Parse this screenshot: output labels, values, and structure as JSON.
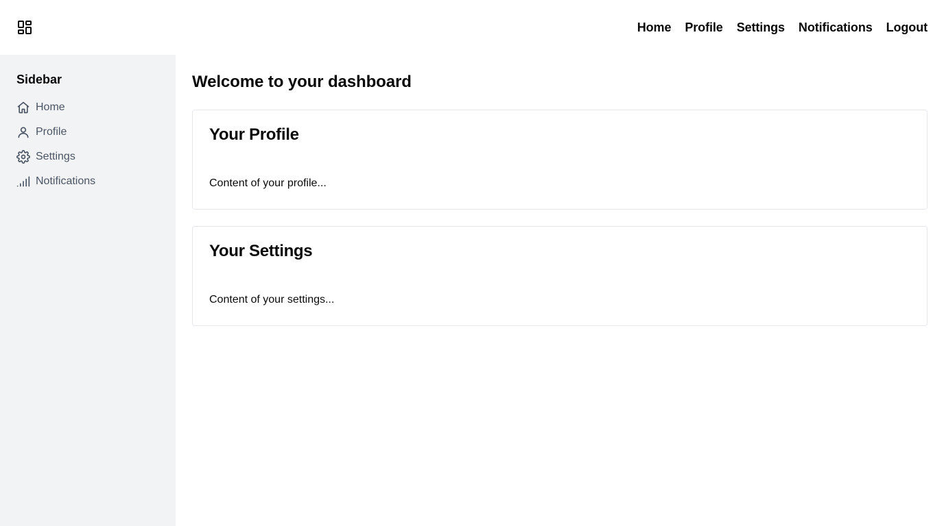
{
  "header": {
    "logo_icon": "dashboard-grid-icon",
    "nav": {
      "home": "Home",
      "profile": "Profile",
      "settings": "Settings",
      "notifications": "Notifications",
      "logout": "Logout"
    }
  },
  "sidebar": {
    "title": "Sidebar",
    "items": [
      {
        "label": "Home",
        "icon": "home-icon"
      },
      {
        "label": "Profile",
        "icon": "user-icon"
      },
      {
        "label": "Settings",
        "icon": "gear-icon"
      },
      {
        "label": "Notifications",
        "icon": "signal-bars-icon"
      }
    ]
  },
  "main": {
    "title": "Welcome to your dashboard",
    "cards": [
      {
        "title": "Your Profile",
        "content": "Content of your profile..."
      },
      {
        "title": "Your Settings",
        "content": "Content of your settings..."
      }
    ]
  },
  "colors": {
    "sidebar_bg": "#f2f3f5",
    "sidebar_text": "#4b5563",
    "card_border": "#e5e7eb",
    "text": "#0a0a0a"
  }
}
